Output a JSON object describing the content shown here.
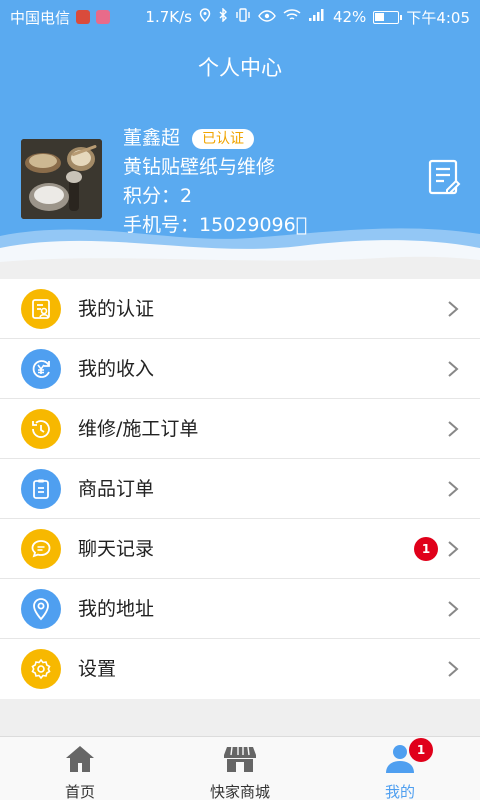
{
  "status_bar": {
    "carrier": "中国电信",
    "speed": "1.7K/s",
    "battery": "42%",
    "battery_level": 0.42,
    "time": "下午4:05"
  },
  "page": {
    "title": "个人中心"
  },
  "profile": {
    "name": "董鑫超",
    "verified_badge": "已认证",
    "shop_name": "黄钻贴壁纸与维修",
    "points_line": "积分：2",
    "phone_line": "手机号：15029096\u0000"
  },
  "menu": {
    "items": [
      {
        "label": "我的认证",
        "icon": "certificate-icon",
        "color": "#f7b800"
      },
      {
        "label": "我的收入",
        "icon": "income-icon",
        "color": "#4f9ff0"
      },
      {
        "label": "维修/施工订单",
        "icon": "history-icon",
        "color": "#f7b800"
      },
      {
        "label": "商品订单",
        "icon": "clipboard-icon",
        "color": "#4f9ff0"
      },
      {
        "label": "聊天记录",
        "icon": "chat-icon",
        "color": "#f7b800",
        "badge": "1"
      },
      {
        "label": "我的地址",
        "icon": "location-pin-icon",
        "color": "#4f9ff0"
      },
      {
        "label": "设置",
        "icon": "gear-icon",
        "color": "#f7b800"
      }
    ]
  },
  "bottom_nav": {
    "items": [
      {
        "label": "首页",
        "icon": "home-icon"
      },
      {
        "label": "快家商城",
        "icon": "store-icon"
      },
      {
        "label": "我的",
        "icon": "user-icon",
        "active": true,
        "badge": "1"
      }
    ]
  },
  "colors": {
    "header_blue": "#5aaaf0",
    "accent_yellow": "#f7b800",
    "accent_blue": "#4f9ff0",
    "badge_red": "#e0001a"
  }
}
